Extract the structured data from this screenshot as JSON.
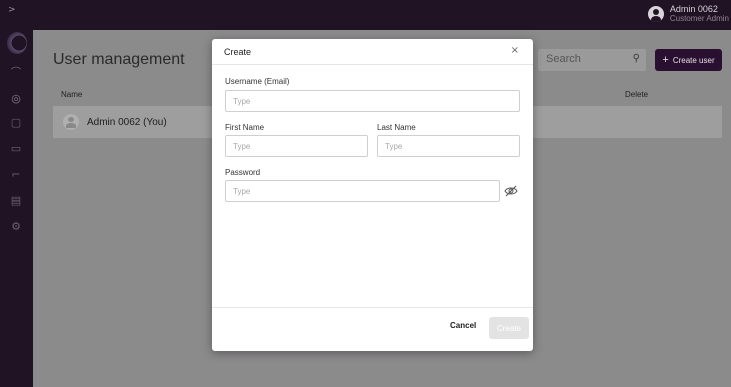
{
  "topbar": {
    "expand_icon": "chevron-right-icon",
    "expand_glyph": ">",
    "user": {
      "name": "Admin 0062",
      "role": "Customer Admin",
      "icon": "user-avatar-icon"
    }
  },
  "sidebar": {
    "items": [
      {
        "icon": "antenna-icon",
        "glyph": "⌒"
      },
      {
        "icon": "user-circle-icon",
        "glyph": "◎"
      },
      {
        "icon": "building-icon",
        "glyph": "▢"
      },
      {
        "icon": "air-conditioner-icon",
        "glyph": "▭"
      },
      {
        "icon": "faucet-icon",
        "glyph": "⌐"
      },
      {
        "icon": "printer-icon",
        "glyph": "▤"
      },
      {
        "icon": "settings-icon",
        "glyph": "⚙"
      }
    ]
  },
  "main": {
    "title": "User management",
    "search": {
      "placeholder": "Search",
      "icon": "search-icon",
      "glyph": "⚲"
    },
    "create_user_button": {
      "plus": "+",
      "label": "Create user"
    },
    "table": {
      "columns": [
        "Name",
        "Delete"
      ],
      "rows": [
        {
          "name": "Admin 0062 (You)"
        }
      ]
    }
  },
  "modal": {
    "title": "Create",
    "close_glyph": "×",
    "fields": {
      "username": {
        "label": "Username (Email)",
        "placeholder": "Type",
        "value": ""
      },
      "first_name": {
        "label": "First Name",
        "placeholder": "Type",
        "value": ""
      },
      "last_name": {
        "label": "Last Name",
        "placeholder": "Type",
        "value": ""
      },
      "password": {
        "label": "Password",
        "placeholder": "Type",
        "value": ""
      }
    },
    "cancel_label": "Cancel",
    "create_label": "Create"
  },
  "colors": {
    "sidebar_bg": "#1f1324",
    "accent": "#2a1030",
    "overlay_gray": "#8c8b8c",
    "disabled_button": "#e3e3e3"
  }
}
